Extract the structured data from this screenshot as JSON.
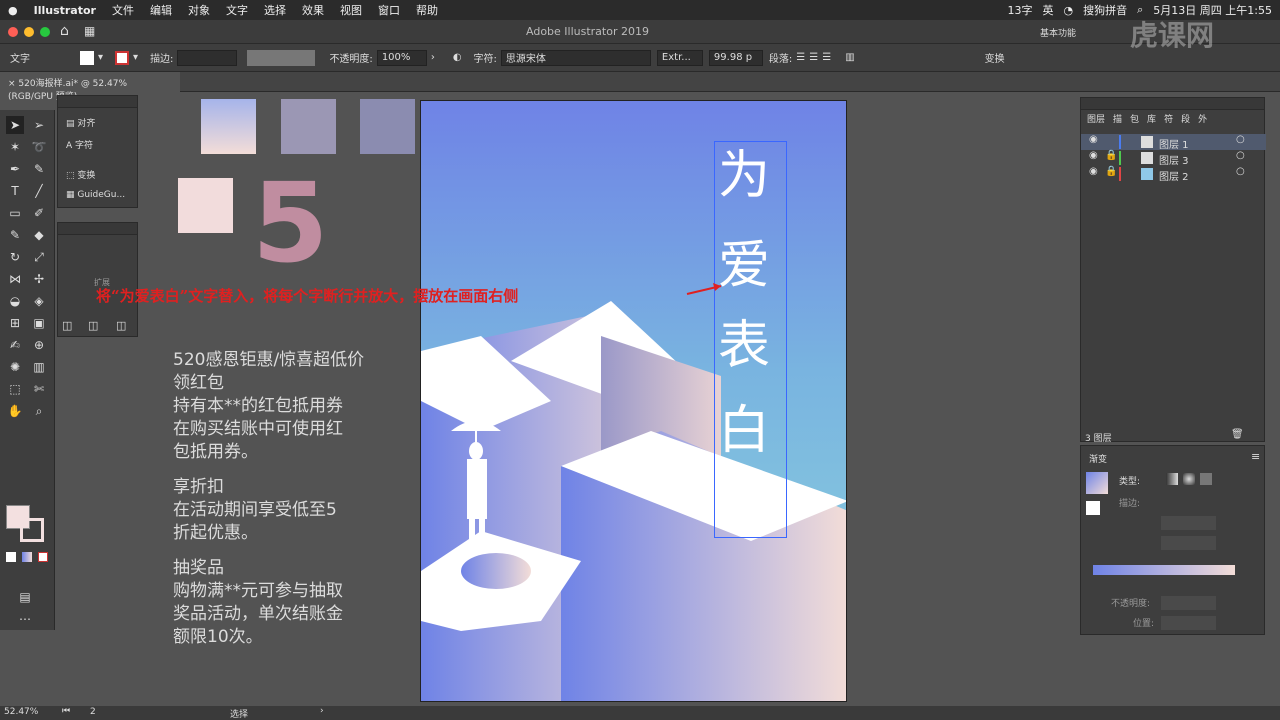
{
  "menubar": {
    "app": "Illustrator",
    "menus": [
      "文件",
      "编辑",
      "对象",
      "文字",
      "选择",
      "效果",
      "视图",
      "窗口",
      "帮助"
    ],
    "right": {
      "input": "13字",
      "lang": "英",
      "ime": "搜狗拼音",
      "datetime": "5月13日 周四 上午1:55"
    }
  },
  "titlebar": {
    "title": "Adobe Illustrator 2019",
    "workspace": "基本功能"
  },
  "control": {
    "type_label": "文字",
    "stroke_label": "描边:",
    "opacity_label": "不透明度:",
    "opacity_value": "100%",
    "char_label": "字符:",
    "font_name": "思源宋体",
    "font_style": "Extr...",
    "font_size": "99.98 p",
    "para_label": "段落:",
    "transform_label": "变换"
  },
  "document": {
    "tab": "520海报样.ai* @ 52.47% (RGB/GPU 预览)"
  },
  "side_panel": {
    "items": [
      "对齐",
      "字符",
      "变换",
      "GuideGu..."
    ],
    "expand_label": "扩展"
  },
  "canvas_text": {
    "big_number": "5",
    "offer_title": "520感恩钜惠/惊喜超低价",
    "sec1_title": "领红包",
    "sec1_body": [
      "持有本**的红包抵用券",
      "在购买结账中可使用红",
      "包抵用券。"
    ],
    "sec2_title": "享折扣",
    "sec2_body": [
      "在活动期间享受低至5",
      "折起优惠。"
    ],
    "sec3_title": "抽奖品",
    "sec3_body": [
      "购物满**元可参与抽取",
      "奖品活动，单次结账金",
      "额限10次。"
    ]
  },
  "annotation": "将“为爱表白”文字替入，将每个字断行并放大，摆放在画面右侧",
  "poster": {
    "chars": [
      "为",
      "爱",
      "表",
      "白"
    ]
  },
  "layers": {
    "tabs": [
      "图层",
      "描",
      "包",
      "库",
      "符",
      "段",
      "外"
    ],
    "rows": [
      {
        "name": "图层 1",
        "color": "#4a7cf0"
      },
      {
        "name": "图层 3",
        "color": "#4fc94f"
      },
      {
        "name": "图层 2",
        "color": "#e04545"
      }
    ],
    "count": "3 图层"
  },
  "gradient": {
    "title": "渐变",
    "type_label": "类型:",
    "stroke_label": "描边:",
    "opacity_label": "不透明度:",
    "position_label": "位置:"
  },
  "status": {
    "zoom": "52.47%",
    "page": "2",
    "tool": "选择"
  },
  "watermark": "虎课网",
  "colors": {
    "swatch1": "#a6b4ea",
    "swatch2": "#9b97b4",
    "swatch3": "#8b8cb0",
    "pink": "#c08da0",
    "gradient_start": "#6f83e6",
    "gradient_end": "#f3ddd8"
  }
}
